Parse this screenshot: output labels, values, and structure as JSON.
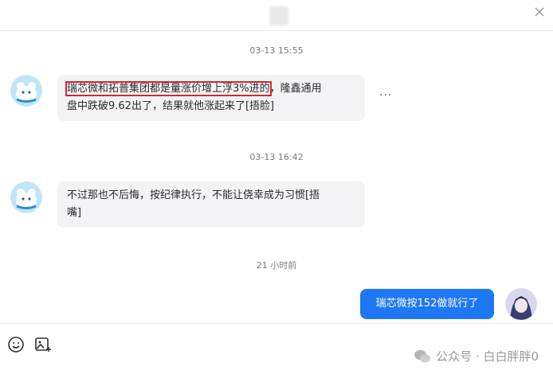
{
  "header": {
    "close_icon": "close-icon"
  },
  "messages": [
    {
      "timestamp": "03-13 15:55",
      "highlighted_text": "瑞芯微和拓普集团都是量涨价增上浮3%进的",
      "line1_rest": "，隆鑫通用",
      "line2": "盘中跌破9.62出了，结果就他涨起来了[捂脸]"
    },
    {
      "timestamp": "03-13 16:42",
      "line1": "不过那也不后悔，按纪律执行，不能让侥幸成为习惯[捂",
      "line2": "嘴]"
    },
    {
      "timestamp": "21 小时前",
      "sent_text": "瑞芯微按152做就行了"
    }
  ],
  "more_label": "...",
  "toolbar": {
    "emoji_icon": "emoji-icon",
    "image_icon": "image-icon"
  },
  "watermark": "公众号 · 白白胖胖0",
  "colors": {
    "accent": "#1e78f5",
    "bubble": "#f3f3f6",
    "highlight": "#d9262d"
  }
}
